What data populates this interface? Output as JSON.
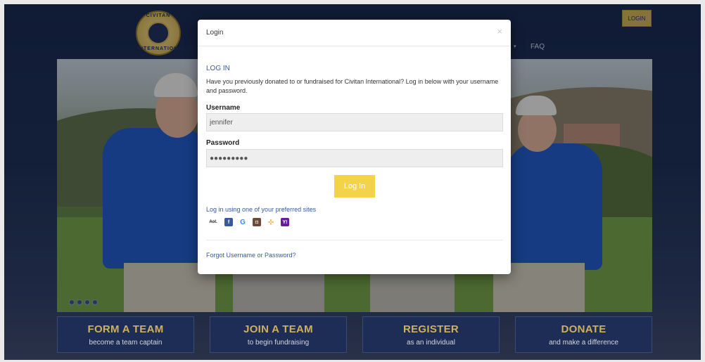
{
  "header": {
    "logo_top_text": "CIVITAN",
    "logo_bottom_text": "INTERNATIONAL",
    "login_button": "LOGIN",
    "nav_caret": "▾",
    "nav_faq": "FAQ"
  },
  "modal": {
    "title": "Login",
    "close_icon": "×",
    "section_heading": "LOG IN",
    "intro": "Have you previously donated to or fundraised for Civitan International? Log in below with your username and password.",
    "username_label": "Username",
    "username_value": "jennifer",
    "password_label": "Password",
    "password_value": "●●●●●●●●●",
    "submit_label": "Log In",
    "social_label": "Log in using one of your preferred sites",
    "social_sites": [
      {
        "name": "aol-icon",
        "glyph": "Aol.",
        "color": "#111111"
      },
      {
        "name": "facebook-icon",
        "glyph": "f",
        "color": "#3b5998"
      },
      {
        "name": "google-icon",
        "glyph": "G",
        "color": "#4285f4"
      },
      {
        "name": "instagram-icon",
        "glyph": "◘",
        "color": "#6b4a3a"
      },
      {
        "name": "odnoklassniki-icon",
        "glyph": "⊹",
        "color": "#f39c12"
      },
      {
        "name": "yahoo-icon",
        "glyph": "Y!",
        "color": "#6a1b9a"
      }
    ],
    "forgot_link": "Forgot Username or Password?"
  },
  "cta_buttons": [
    {
      "title": "FORM A TEAM",
      "subtitle": "become a team captain"
    },
    {
      "title": "JOIN A TEAM",
      "subtitle": "to begin fundraising"
    },
    {
      "title": "REGISTER",
      "subtitle": "as an individual"
    },
    {
      "title": "DONATE",
      "subtitle": "and make a difference"
    }
  ],
  "colors": {
    "navy": "#1e2d55",
    "gold": "#cfb15a",
    "submit_yellow": "#f3d34a",
    "link_blue": "#3a5a9c"
  }
}
